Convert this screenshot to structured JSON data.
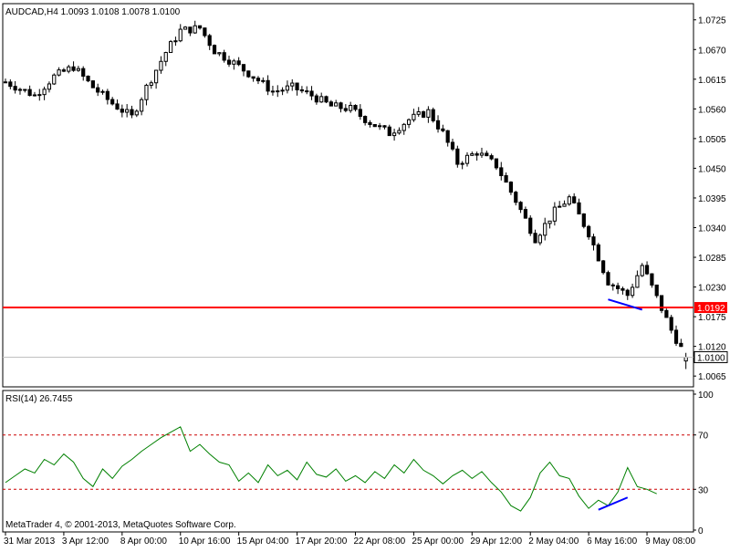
{
  "chart_data": [
    {
      "type": "candlestick",
      "title": "AUDCAD,H4  1.0093 1.0108 1.0078 1.0100",
      "ylim": [
        1.0045,
        1.0755
      ],
      "y_ticks": [
        "1.0725",
        "1.0670",
        "1.0615",
        "1.0560",
        "1.0505",
        "1.0450",
        "1.0395",
        "1.0340",
        "1.0285",
        "1.0230",
        "1.0175",
        "1.0120",
        "1.0065"
      ],
      "horizontal_lines": [
        {
          "label": "1.0192",
          "value": 1.0192,
          "color": "#ff0000"
        },
        {
          "label": "1.0100",
          "value": 1.01,
          "color": "#c0c0c0"
        }
      ],
      "ohlc": [],
      "trendline": {
        "x": [
          124,
          131
        ],
        "y": [
          1.0207,
          1.0188
        ],
        "color": "#0000ff"
      },
      "price_path": [
        [
          0,
          1.061
        ],
        [
          6,
          1.0585
        ],
        [
          10,
          1.062
        ],
        [
          14,
          1.0638
        ],
        [
          18,
          1.06
        ],
        [
          22,
          1.057
        ],
        [
          26,
          1.0545
        ],
        [
          29,
          1.06
        ],
        [
          33,
          1.0665
        ],
        [
          36,
          1.0705
        ],
        [
          40,
          1.071
        ],
        [
          43,
          1.0668
        ],
        [
          47,
          1.0645
        ],
        [
          51,
          1.062
        ],
        [
          55,
          1.0592
        ],
        [
          59,
          1.06
        ],
        [
          63,
          1.0585
        ],
        [
          67,
          1.0565
        ],
        [
          71,
          1.056
        ],
        [
          75,
          1.0535
        ],
        [
          79,
          1.0515
        ],
        [
          83,
          1.054
        ],
        [
          87,
          1.0555
        ],
        [
          90,
          1.0515
        ],
        [
          93,
          1.046
        ],
        [
          97,
          1.048
        ],
        [
          101,
          1.0455
        ],
        [
          105,
          1.039
        ],
        [
          109,
          1.032
        ],
        [
          113,
          1.037
        ],
        [
          116,
          1.0395
        ],
        [
          120,
          1.033
        ],
        [
          124,
          1.024
        ],
        [
          128,
          1.0215
        ],
        [
          131,
          1.027
        ],
        [
          134,
          1.021
        ],
        [
          137,
          1.015
        ],
        [
          140,
          1.01
        ]
      ]
    },
    {
      "type": "line",
      "title": "RSI(14) 26.7455",
      "ylim": [
        0,
        100
      ],
      "y_ticks": [
        "100",
        "70",
        "30",
        "0"
      ],
      "levels": [
        70,
        30
      ],
      "series": [
        {
          "name": "RSI(14)",
          "color": "#008000",
          "values": [
            [
              0,
              35
            ],
            [
              2,
              40
            ],
            [
              4,
              45
            ],
            [
              6,
              42
            ],
            [
              8,
              52
            ],
            [
              10,
              48
            ],
            [
              12,
              56
            ],
            [
              14,
              50
            ],
            [
              16,
              38
            ],
            [
              18,
              32
            ],
            [
              20,
              45
            ],
            [
              22,
              38
            ],
            [
              24,
              47
            ],
            [
              26,
              52
            ],
            [
              28,
              58
            ],
            [
              30,
              63
            ],
            [
              32,
              68
            ],
            [
              34,
              72
            ],
            [
              36,
              76
            ],
            [
              38,
              58
            ],
            [
              40,
              63
            ],
            [
              42,
              56
            ],
            [
              44,
              50
            ],
            [
              46,
              48
            ],
            [
              48,
              36
            ],
            [
              50,
              42
            ],
            [
              52,
              35
            ],
            [
              54,
              48
            ],
            [
              56,
              40
            ],
            [
              58,
              44
            ],
            [
              60,
              37
            ],
            [
              62,
              50
            ],
            [
              64,
              41
            ],
            [
              66,
              39
            ],
            [
              68,
              45
            ],
            [
              70,
              36
            ],
            [
              72,
              40
            ],
            [
              74,
              35
            ],
            [
              76,
              43
            ],
            [
              78,
              38
            ],
            [
              80,
              48
            ],
            [
              82,
              42
            ],
            [
              84,
              52
            ],
            [
              86,
              44
            ],
            [
              88,
              40
            ],
            [
              90,
              34
            ],
            [
              92,
              40
            ],
            [
              94,
              44
            ],
            [
              96,
              38
            ],
            [
              98,
              43
            ],
            [
              100,
              35
            ],
            [
              102,
              28
            ],
            [
              104,
              18
            ],
            [
              106,
              14
            ],
            [
              108,
              24
            ],
            [
              110,
              42
            ],
            [
              112,
              50
            ],
            [
              114,
              40
            ],
            [
              116,
              38
            ],
            [
              118,
              25
            ],
            [
              120,
              16
            ],
            [
              122,
              22
            ],
            [
              124,
              18
            ],
            [
              126,
              28
            ],
            [
              128,
              46
            ],
            [
              130,
              32
            ],
            [
              132,
              30
            ],
            [
              134,
              26.7
            ]
          ]
        }
      ],
      "trendline": {
        "x": [
          122,
          128
        ],
        "y": [
          15,
          24
        ],
        "color": "#0000ff"
      }
    }
  ],
  "x_ticks": [
    {
      "label": "31 Mar 2013",
      "x": 0
    },
    {
      "label": "3 Apr 12:00",
      "x": 12
    },
    {
      "label": "8 Apr 00:00",
      "x": 24
    },
    {
      "label": "10 Apr 16:00",
      "x": 36
    },
    {
      "label": "15 Apr 04:00",
      "x": 48
    },
    {
      "label": "17 Apr 20:00",
      "x": 60
    },
    {
      "label": "22 Apr 08:00",
      "x": 72
    },
    {
      "label": "25 Apr 00:00",
      "x": 84
    },
    {
      "label": "29 Apr 12:00",
      "x": 96
    },
    {
      "label": "2 May 04:00",
      "x": 108
    },
    {
      "label": "6 May 16:00",
      "x": 120
    },
    {
      "label": "9 May 08:00",
      "x": 132
    }
  ],
  "copyright": "MetaTrader 4, © 2001-2013, MetaQuotes Software Corp."
}
